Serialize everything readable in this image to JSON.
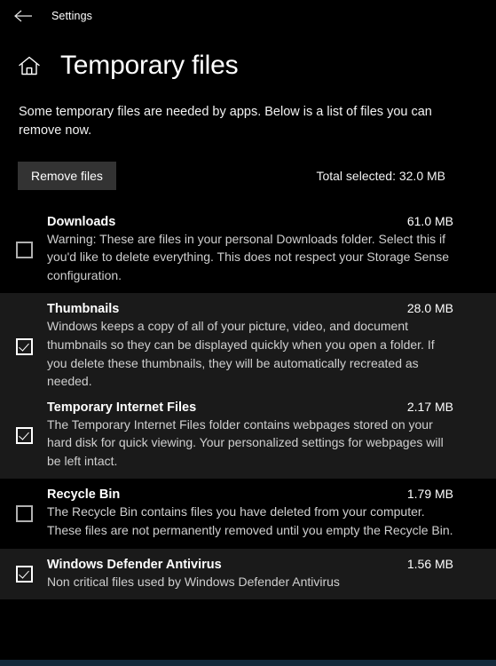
{
  "titlebar": {
    "back_icon": "back-arrow-icon",
    "app_title": "Settings"
  },
  "header": {
    "home_icon": "home-icon",
    "page_title": "Temporary files"
  },
  "intro": {
    "text": "Some temporary files are needed by apps. Below is a list of files you can remove now."
  },
  "toolbar": {
    "remove_label": "Remove files",
    "total_selected": "Total selected: 32.0 MB"
  },
  "files": [
    {
      "name": "Downloads",
      "size": "61.0 MB",
      "description": "Warning: These are files in your personal Downloads folder. Select this if you'd like to delete everything. This does not respect your Storage Sense configuration.",
      "checked": false,
      "highlighted": false
    },
    {
      "name": "Thumbnails",
      "size": "28.0 MB",
      "description": "Windows keeps a copy of all of your picture, video, and document thumbnails so they can be displayed quickly when you open a folder. If you delete these thumbnails, they will be automatically recreated as needed.",
      "checked": true,
      "highlighted": true
    },
    {
      "name": "Temporary Internet Files",
      "size": "2.17 MB",
      "description": "The Temporary Internet Files folder contains webpages stored on your hard disk for quick viewing. Your personalized settings for webpages will be left intact.",
      "checked": true,
      "highlighted": true
    },
    {
      "name": "Recycle Bin",
      "size": "1.79 MB",
      "description": "The Recycle Bin contains files you have deleted from your computer. These files are not permanently removed until you empty the Recycle Bin.",
      "checked": false,
      "highlighted": false
    },
    {
      "name": "Windows Defender Antivirus",
      "size": "1.56 MB",
      "description": "Non critical files used by Windows Defender Antivirus",
      "checked": true,
      "highlighted": true
    }
  ],
  "colors": {
    "background": "#000000",
    "row_highlight": "#1a1a1a",
    "button": "#333333",
    "bottom_strip": "#14293a",
    "text_primary": "#ffffff",
    "text_secondary": "#cfcfcf"
  }
}
